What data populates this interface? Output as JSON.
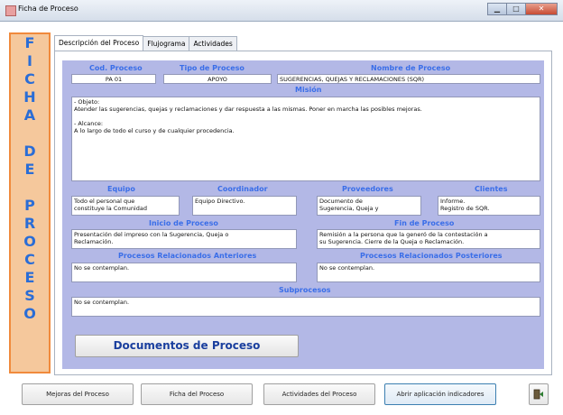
{
  "window": {
    "title": "Ficha de Proceso"
  },
  "sidebar": {
    "letters": [
      "F",
      "I",
      "C",
      "H",
      "A",
      "",
      "D",
      "E",
      "",
      "P",
      "R",
      "O",
      "C",
      "E",
      "S",
      "O"
    ]
  },
  "tabs": [
    {
      "label": "Descripción del Proceso",
      "active": true
    },
    {
      "label": "Flujograma",
      "active": false
    },
    {
      "label": "Actividades",
      "active": false
    }
  ],
  "form": {
    "cod_proceso": {
      "label": "Cod. Proceso",
      "value": "PA 01"
    },
    "tipo_proceso": {
      "label": "Tipo de Proceso",
      "value": "APOYO"
    },
    "nombre_proceso": {
      "label": "Nombre de Proceso",
      "value": "SUGERENCIAS, QUEJAS Y RECLAMACIONES (SQR)"
    },
    "mision": {
      "label": "Misión",
      "value": "- Objeto:\nAtender las sugerencias, quejas y reclamaciones y dar respuesta a las mismas. Poner en marcha las posibles mejoras.\n\n- Alcance:\nA lo largo de todo el curso y de cualquier procedencia."
    },
    "equipo": {
      "label": "Equipo",
      "value": "Todo el personal que\nconstituye la Comunidad"
    },
    "coordinador": {
      "label": "Coordinador",
      "value": "Equipo Directivo."
    },
    "proveedores": {
      "label": "Proveedores",
      "value": "Documento de\nSugerencia, Queja y"
    },
    "clientes": {
      "label": "Clientes",
      "value": "Informe.\nRegistro de SQR."
    },
    "inicio": {
      "label": "Inicio de Proceso",
      "value": "Presentación del impreso con la Sugerencia, Queja o\nReclamación."
    },
    "fin": {
      "label": "Fin de Proceso",
      "value": "Remisión a la persona que la generó de la contestación a\nsu Sugerencia. Cierre de la Queja o Reclamación."
    },
    "rel_anteriores": {
      "label": "Procesos Relacionados Anteriores",
      "value": "No se contemplan."
    },
    "rel_posteriores": {
      "label": "Procesos Relacionados Posteriores",
      "value": "No se contemplan."
    },
    "subprocesos": {
      "label": "Subprocesos",
      "value": "No se contemplan."
    }
  },
  "buttons": {
    "documentos": "Documentos de Proceso",
    "mejoras": "Mejoras del Proceso",
    "ficha": "Ficha del Proceso",
    "actividades": "Actividades del Proceso",
    "indicadores": "Abrir aplicación indicadores"
  },
  "colors": {
    "sidebar_bg": "#f5c89c",
    "sidebar_border": "#f08a3c",
    "panel_bg": "#b3b8e6",
    "label_blue": "#3a6ee8"
  },
  "icons": {
    "exit": "exit-door-icon",
    "app": "form-icon"
  }
}
